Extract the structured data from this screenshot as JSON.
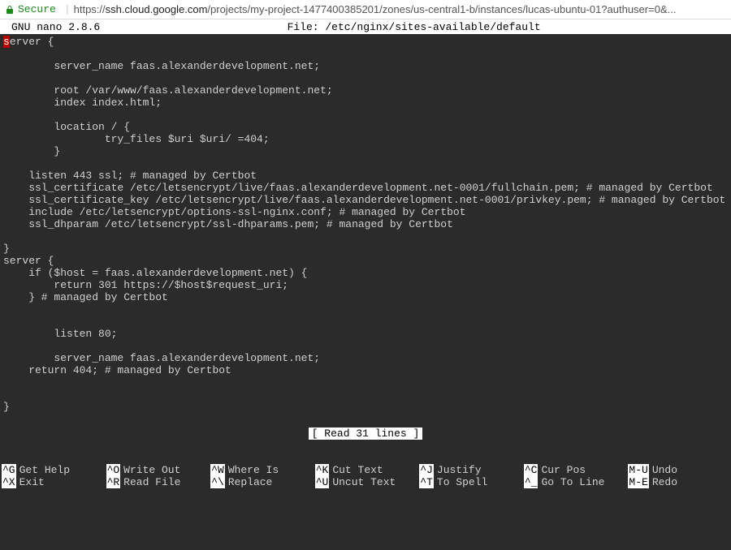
{
  "browser": {
    "secure_label": "Secure",
    "url_prefix": "https://",
    "url_host": "ssh.cloud.google.com",
    "url_path": "/projects/my-project-1477400385201/zones/us-central1-b/instances/lucas-ubuntu-01?authuser=0&..."
  },
  "nano": {
    "version": "GNU nano 2.8.6",
    "file_label": "File: /etc/nginx/sites-available/default",
    "status": "[ Read 31 lines ]"
  },
  "editor": {
    "cursor_char": "s",
    "rest_of_first_line": "erver {",
    "body": "\n\n        server_name faas.alexanderdevelopment.net;\n\n        root /var/www/faas.alexanderdevelopment.net;\n        index index.html;\n\n        location / {\n                try_files $uri $uri/ =404;\n        }\n\n    listen 443 ssl; # managed by Certbot\n    ssl_certificate /etc/letsencrypt/live/faas.alexanderdevelopment.net-0001/fullchain.pem; # managed by Certbot\n    ssl_certificate_key /etc/letsencrypt/live/faas.alexanderdevelopment.net-0001/privkey.pem; # managed by Certbot\n    include /etc/letsencrypt/options-ssl-nginx.conf; # managed by Certbot\n    ssl_dhparam /etc/letsencrypt/ssl-dhparams.pem; # managed by Certbot\n\n}\nserver {\n    if ($host = faas.alexanderdevelopment.net) {\n        return 301 https://$host$request_uri;\n    } # managed by Certbot\n\n\n        listen 80;\n\n        server_name faas.alexanderdevelopment.net;\n    return 404; # managed by Certbot\n\n\n}"
  },
  "shortcuts": {
    "row1": [
      {
        "key": "^G",
        "label": "Get Help"
      },
      {
        "key": "^O",
        "label": "Write Out"
      },
      {
        "key": "^W",
        "label": "Where Is"
      },
      {
        "key": "^K",
        "label": "Cut Text"
      },
      {
        "key": "^J",
        "label": "Justify"
      },
      {
        "key": "^C",
        "label": "Cur Pos"
      },
      {
        "key": "M-U",
        "label": "Undo"
      }
    ],
    "row2": [
      {
        "key": "^X",
        "label": "Exit"
      },
      {
        "key": "^R",
        "label": "Read File"
      },
      {
        "key": "^\\",
        "label": "Replace"
      },
      {
        "key": "^U",
        "label": "Uncut Text"
      },
      {
        "key": "^T",
        "label": "To Spell"
      },
      {
        "key": "^_",
        "label": "Go To Line"
      },
      {
        "key": "M-E",
        "label": "Redo"
      }
    ]
  }
}
